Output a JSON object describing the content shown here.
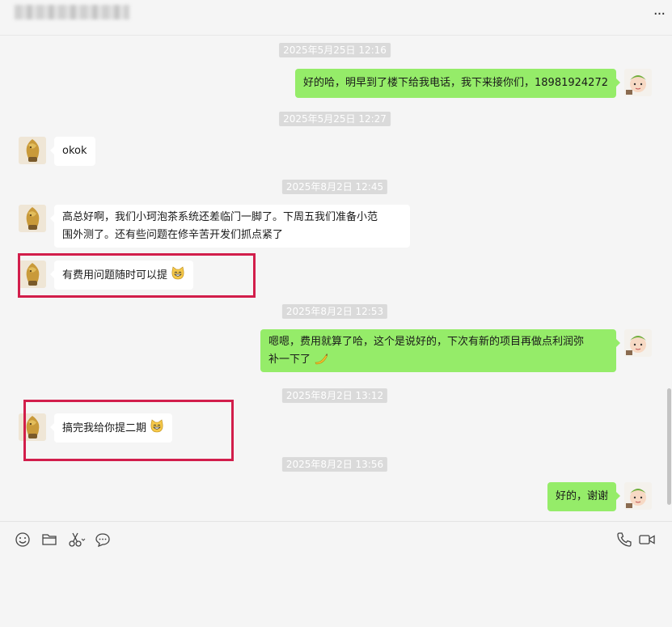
{
  "chat": {
    "messages": [
      {
        "type": "timestamp",
        "text": "2025年5月25日 12:16"
      },
      {
        "type": "message",
        "side": "out",
        "text": "好的哈，明早到了楼下给我电话，我下来接你们，18981924272"
      },
      {
        "type": "timestamp",
        "text": "2025年5月25日 12:27"
      },
      {
        "type": "message",
        "side": "in",
        "text": "okok"
      },
      {
        "type": "timestamp",
        "text": "2025年8月2日 12:45"
      },
      {
        "type": "message",
        "side": "in",
        "lines": [
          "高总好啊，我们小珂泡茶系统还差临门一脚了。下周五我们准备小范",
          "围外测了。还有些问题在修辛苦开发们抓点紧了"
        ]
      },
      {
        "type": "message",
        "side": "in",
        "text": "有费用问题随时可以提",
        "emoji": "cat-grin-emoji",
        "highlighted": true
      },
      {
        "type": "timestamp",
        "text": "2025年8月2日 12:53"
      },
      {
        "type": "message",
        "side": "out",
        "lines": [
          "嗯嗯，费用就算了哈，这个是说好的，下次有新的项目再做点利润弥",
          "补一下了"
        ],
        "emoji": "banana-emoji"
      },
      {
        "type": "timestamp",
        "text": "2025年8月2日 13:12"
      },
      {
        "type": "message",
        "side": "in",
        "text": "搞完我给你提二期",
        "emoji": "cat-grin-emoji",
        "highlighted": true
      },
      {
        "type": "timestamp",
        "text": "2025年8月2日 13:56"
      },
      {
        "type": "message",
        "side": "out",
        "text": "好的，谢谢"
      }
    ]
  },
  "header": {
    "more_icon": "more-dots-icon"
  },
  "toolbar": {
    "left_icons": [
      "emoji-icon",
      "folder-icon",
      "scissors-icon",
      "chat-bubble-icon"
    ],
    "right_icons": [
      "phone-icon",
      "video-call-icon"
    ]
  },
  "colors": {
    "outgoing_bubble": "#95ec69",
    "incoming_bubble": "#ffffff",
    "highlight_border": "#d21e4b",
    "background": "#f5f5f5"
  }
}
